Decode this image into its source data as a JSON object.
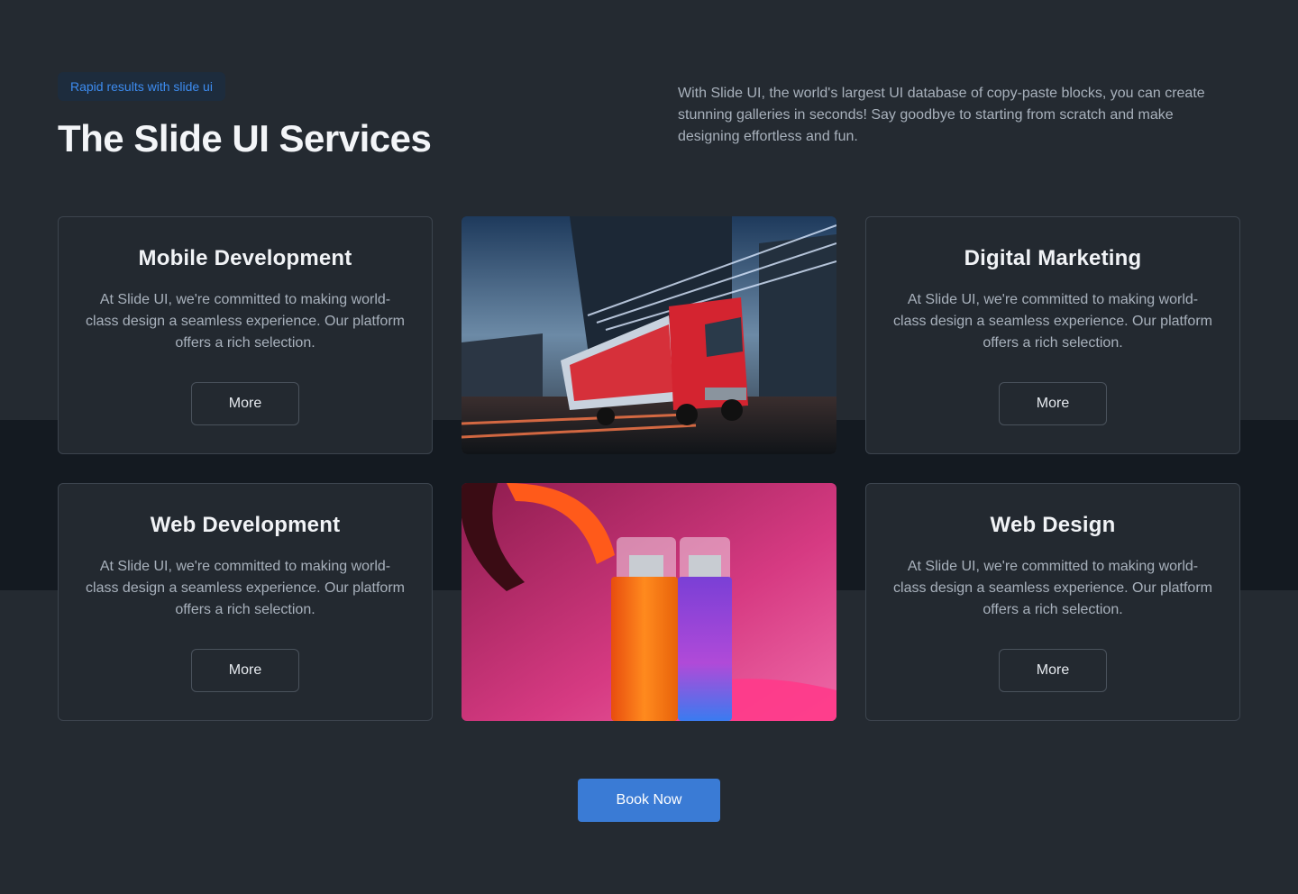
{
  "header": {
    "badge": "Rapid results with slide ui",
    "title": "The Slide UI Services",
    "description": "With Slide UI, the world's largest UI database of copy-paste blocks, you can create stunning galleries in seconds! Say goodbye to starting from scratch and make designing effortless and fun."
  },
  "services": [
    {
      "title": "Mobile Development",
      "text": "At Slide UI, we're committed to making world-class design a seamless experience. Our platform offers a rich selection.",
      "button": "More"
    },
    {
      "title": "Digital Marketing",
      "text": "At Slide UI, we're committed to making world-class design a seamless experience. Our platform offers a rich selection.",
      "button": "More"
    },
    {
      "title": "Web Development",
      "text": "At Slide UI, we're committed to making world-class design a seamless experience. Our platform offers a rich selection.",
      "button": "More"
    },
    {
      "title": "Web Design",
      "text": "At Slide UI, we're committed to making world-class design a seamless experience. Our platform offers a rich selection.",
      "button": "More"
    }
  ],
  "images": {
    "top": "red-truck-night-photo",
    "bottom": "cosmetic-bottles-pink-photo"
  },
  "cta": {
    "label": "Book Now"
  },
  "colors": {
    "background": "#242a31",
    "band": "#141a21",
    "accent": "#3a7bd5",
    "badge_text": "#3d8cf0"
  }
}
